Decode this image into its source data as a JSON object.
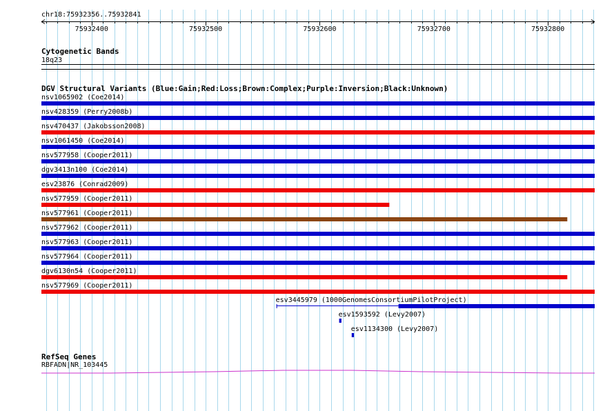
{
  "region": {
    "label": "chr18:75932356..75932841",
    "start": 75932356,
    "end": 75932841,
    "ticks": [
      "75932400",
      "75932500",
      "75932600",
      "75932700",
      "75932800"
    ]
  },
  "tracks": {
    "cytoband": {
      "title": "Cytogenetic Bands",
      "band_label": "18q23"
    },
    "dgv": {
      "title": "DGV Structural Variants (Blue:Gain;Red:Loss;Brown:Complex;Purple:Inversion;Black:Unknown)",
      "colors": {
        "gain": "#0000cc",
        "loss": "#ee0000",
        "complex": "#8b4513",
        "inversion": "#800080",
        "unknown": "#000000"
      },
      "variants": [
        {
          "label": "nsv1065902 (Coe2014)",
          "type": "gain",
          "start": 75932356,
          "end": 75932841
        },
        {
          "label": "nsv428359 (Perry2008b)",
          "type": "gain",
          "start": 75932356,
          "end": 75932841
        },
        {
          "label": "nsv470437 (Jakobsson2008)",
          "type": "loss",
          "start": 75932356,
          "end": 75932841
        },
        {
          "label": "nsv1061450 (Coe2014)",
          "type": "gain",
          "start": 75932356,
          "end": 75932841
        },
        {
          "label": "nsv577958 (Cooper2011)",
          "type": "gain",
          "start": 75932356,
          "end": 75932841
        },
        {
          "label": "dgv3413n100 (Coe2014)",
          "type": "gain",
          "start": 75932356,
          "end": 75932841
        },
        {
          "label": "esv23876 (Conrad2009)",
          "type": "loss",
          "start": 75932356,
          "end": 75932841
        },
        {
          "label": "nsv577959 (Cooper2011)",
          "type": "loss",
          "start": 75932356,
          "end": 75932661
        },
        {
          "label": "nsv577961 (Cooper2011)",
          "type": "complex",
          "start": 75932356,
          "end": 75932817
        },
        {
          "label": "nsv577962 (Cooper2011)",
          "type": "gain",
          "start": 75932356,
          "end": 75932841
        },
        {
          "label": "nsv577963 (Cooper2011)",
          "type": "gain",
          "start": 75932356,
          "end": 75932841
        },
        {
          "label": "nsv577964 (Cooper2011)",
          "type": "gain",
          "start": 75932356,
          "end": 75932841
        },
        {
          "label": "dgv6130n54 (Cooper2011)",
          "type": "loss",
          "start": 75932356,
          "end": 75932817
        },
        {
          "label": "nsv577969 (Cooper2011)",
          "type": "loss",
          "start": 75932356,
          "end": 75932841
        },
        {
          "label": "esv3445979 (1000GenomesConsortiumPilotProject)",
          "type": "gain",
          "start": 75932562,
          "end": 75932841,
          "thin_start": 75932562,
          "thick_start": 75932669
        },
        {
          "label": "esv1593592 (Levy2007)",
          "type": "gain",
          "start": 75932617,
          "end": 75932619
        },
        {
          "label": "esv1134300 (Levy2007)",
          "type": "gain",
          "start": 75932628,
          "end": 75932630
        }
      ]
    },
    "refseq": {
      "title": "RefSeq Genes",
      "gene_label": "RBFADN|NR_103445",
      "color": "#cc33cc"
    }
  }
}
